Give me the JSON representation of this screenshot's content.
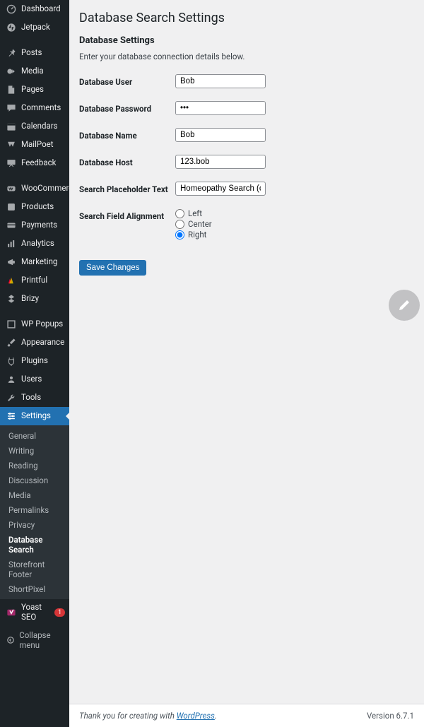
{
  "sidebar": {
    "items": [
      {
        "label": "Dashboard"
      },
      {
        "label": "Jetpack"
      },
      {
        "sep": true
      },
      {
        "label": "Posts"
      },
      {
        "label": "Media"
      },
      {
        "label": "Pages"
      },
      {
        "label": "Comments"
      },
      {
        "label": "Calendars"
      },
      {
        "label": "MailPoet"
      },
      {
        "label": "Feedback"
      },
      {
        "sep": true
      },
      {
        "label": "WooCommerce"
      },
      {
        "label": "Products"
      },
      {
        "label": "Payments"
      },
      {
        "label": "Analytics"
      },
      {
        "label": "Marketing"
      },
      {
        "label": "Printful"
      },
      {
        "label": "Brizy"
      },
      {
        "sep": true
      },
      {
        "label": "WP Popups"
      },
      {
        "label": "Appearance"
      },
      {
        "label": "Plugins"
      },
      {
        "label": "Users"
      },
      {
        "label": "Tools"
      },
      {
        "label": "Settings",
        "active": true
      }
    ],
    "submenu": [
      {
        "label": "General"
      },
      {
        "label": "Writing"
      },
      {
        "label": "Reading"
      },
      {
        "label": "Discussion"
      },
      {
        "label": "Media"
      },
      {
        "label": "Permalinks"
      },
      {
        "label": "Privacy"
      },
      {
        "label": "Database Search",
        "current": true
      },
      {
        "label": "Storefront Footer"
      },
      {
        "label": "ShortPixel"
      }
    ],
    "after": [
      {
        "label": "Yoast SEO",
        "badge": "1"
      }
    ],
    "collapse": "Collapse menu"
  },
  "page": {
    "title": "Database Search Settings",
    "section": "Database Settings",
    "intro": "Enter your database connection details below.",
    "fields": {
      "user_label": "Database User",
      "user_value": "Bob",
      "password_label": "Database Password",
      "password_value": "•••",
      "name_label": "Database Name",
      "name_value": "Bob",
      "host_label": "Database Host",
      "host_value": "123.bob",
      "placeholder_label": "Search Placeholder Text",
      "placeholder_value": "Homeopathy Search (coming s",
      "alignment_label": "Search Field Alignment",
      "alignment_options": {
        "left": "Left",
        "center": "Center",
        "right": "Right"
      },
      "alignment_selected": "right"
    },
    "save": "Save Changes"
  },
  "footer": {
    "thanks": "Thank you for creating with ",
    "wp": "WordPress",
    "version": "Version 6.7.1"
  }
}
